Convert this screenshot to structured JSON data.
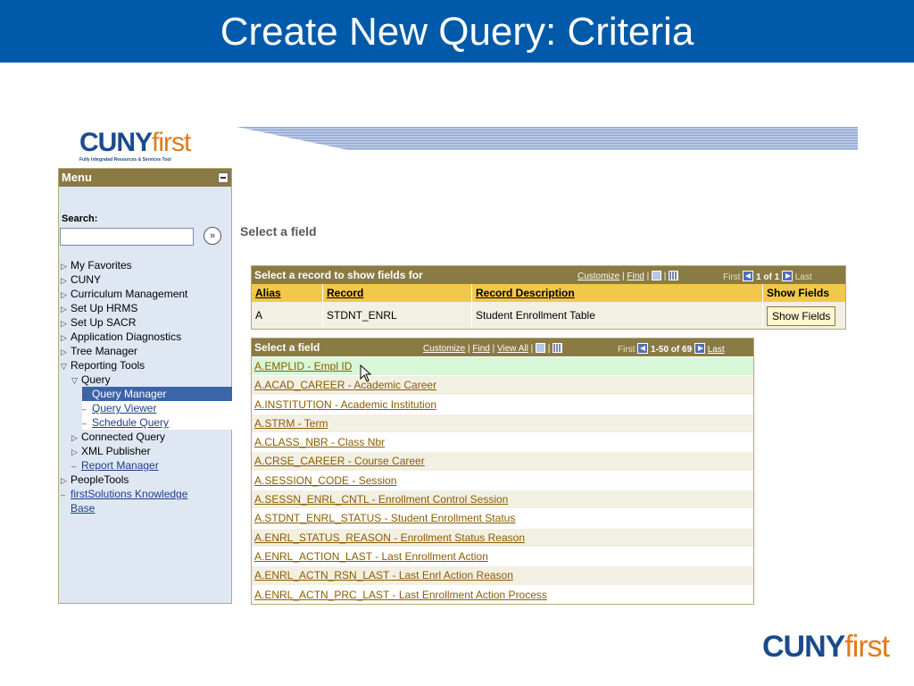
{
  "slide": {
    "title": "Create New Query: Criteria"
  },
  "logo": {
    "brand_main": "CUNY",
    "brand_suffix": "first",
    "tagline": "Fully Integrated Resources & Services Tool"
  },
  "menu": {
    "title": "Menu",
    "search_label": "Search:",
    "search_value": "",
    "go_icon": "»",
    "items": [
      {
        "label": "My Favorites"
      },
      {
        "label": "CUNY"
      },
      {
        "label": "Curriculum Management"
      },
      {
        "label": "Set Up HRMS"
      },
      {
        "label": "Set Up SACR"
      },
      {
        "label": "Application Diagnostics"
      },
      {
        "label": "Tree Manager"
      },
      {
        "label": "Reporting Tools"
      },
      {
        "label": "Query"
      },
      {
        "label": "Query Manager"
      },
      {
        "label": "Query Viewer"
      },
      {
        "label": "Schedule Query"
      },
      {
        "label": "Connected Query"
      },
      {
        "label": "XML Publisher"
      },
      {
        "label": "Report Manager"
      },
      {
        "label": "PeopleTools"
      },
      {
        "label": "firstSolutions Knowledge"
      },
      {
        "label": "Base"
      }
    ]
  },
  "content": {
    "section_title": "Select a field"
  },
  "record_grid": {
    "title": "Select a record to show fields for",
    "customize": "Customize",
    "find": "Find",
    "nav_first": "First",
    "nav_range": "1 of 1",
    "nav_last": "Last",
    "columns": [
      "Alias",
      "Record",
      "Record Description",
      "Show Fields"
    ],
    "row": {
      "alias": "A",
      "record": "STDNT_ENRL",
      "description": "Student Enrollment Table",
      "button": "Show Fields"
    }
  },
  "field_grid": {
    "title": "Select a field",
    "customize": "Customize",
    "find": "Find",
    "view_all": "View All",
    "nav_first": "First",
    "nav_range": "1-50 of 69",
    "nav_last": "Last",
    "fields": [
      "A.EMPLID - Empl ID",
      "A.ACAD_CAREER - Academic Career",
      "A.INSTITUTION - Academic Institution",
      "A.STRM - Term",
      "A.CLASS_NBR - Class Nbr",
      "A.CRSE_CAREER - Course Career",
      "A.SESSION_CODE - Session",
      "A.SESSN_ENRL_CNTL - Enrollment Control Session",
      "A.STDNT_ENRL_STATUS - Student Enrollment Status",
      "A.ENRL_STATUS_REASON - Enrollment Status Reason",
      "A.ENRL_ACTION_LAST - Last Enrollment Action",
      "A.ENRL_ACTN_RSN_LAST - Last Enrl Action Reason",
      "A.ENRL_ACTN_PRC_LAST - Last Enrollment Action Process"
    ]
  },
  "footer_logo": {
    "brand_main": "CUNY",
    "brand_suffix": "first"
  }
}
